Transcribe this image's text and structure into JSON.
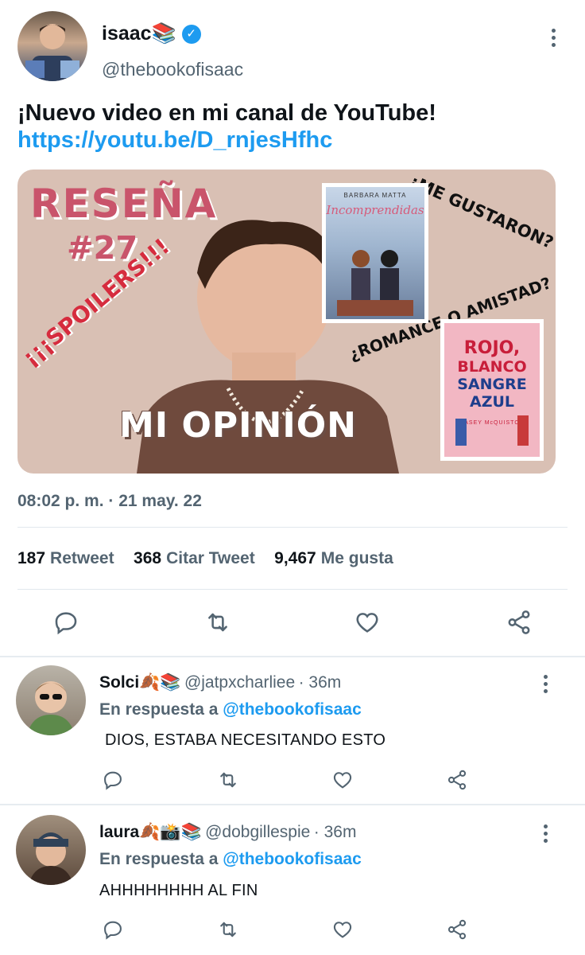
{
  "tweet": {
    "author_name": "isaac📚",
    "author_handle": "@thebookofisaac",
    "text_line": "¡Nuevo video en mi canal de YouTube!",
    "link": "https://youtu.be/D_rnjesHfhc",
    "timestamp": "08:02 p. m. · 21 may. 22",
    "thumbnail": {
      "title": "RESEÑA",
      "number": "#27",
      "spoilers": "¡¡¡SPOILERS!!!",
      "question1": "¿ME GUSTARON?",
      "question2": "¿ROMANCE O AMISTAD?",
      "caption": "MI OPINIÓN",
      "book1_author": "BARBARA MATTA",
      "book1_title": "Incomprendidas",
      "book2_line1": "ROJO,",
      "book2_line2": "BLANCO",
      "book2_line3": "SANGRE",
      "book2_line4": "AZUL",
      "book2_author": "CASEY McQUISTON",
      "bg_color": "#d9c0b4"
    },
    "stats": [
      {
        "count": "187",
        "label": "Retweet"
      },
      {
        "count": "368",
        "label": "Citar Tweet"
      },
      {
        "count": "9,467",
        "label": "Me gusta"
      }
    ]
  },
  "replies": [
    {
      "name": "Solci🍂📚",
      "handle": "@jatpxcharliee",
      "time": "· 36m",
      "reply_prefix": "En respuesta a",
      "reply_to": "@thebookofisaac",
      "text": "DIOS, ESTABA NECESITANDO ESTO"
    },
    {
      "name": "laura🍂📸📚",
      "handle": "@dobgillespie",
      "time": "· 36m",
      "reply_prefix": "En respuesta a",
      "reply_to": "@thebookofisaac",
      "text": "AHHHHHHHH AL FIN"
    }
  ],
  "colors": {
    "accent": "#1d9bf0",
    "secondary_text": "#536471",
    "divider": "#e1e8ed"
  },
  "icons": [
    "verified-badge-icon",
    "more-options-icon",
    "reply-icon",
    "retweet-icon",
    "like-icon",
    "share-icon"
  ]
}
